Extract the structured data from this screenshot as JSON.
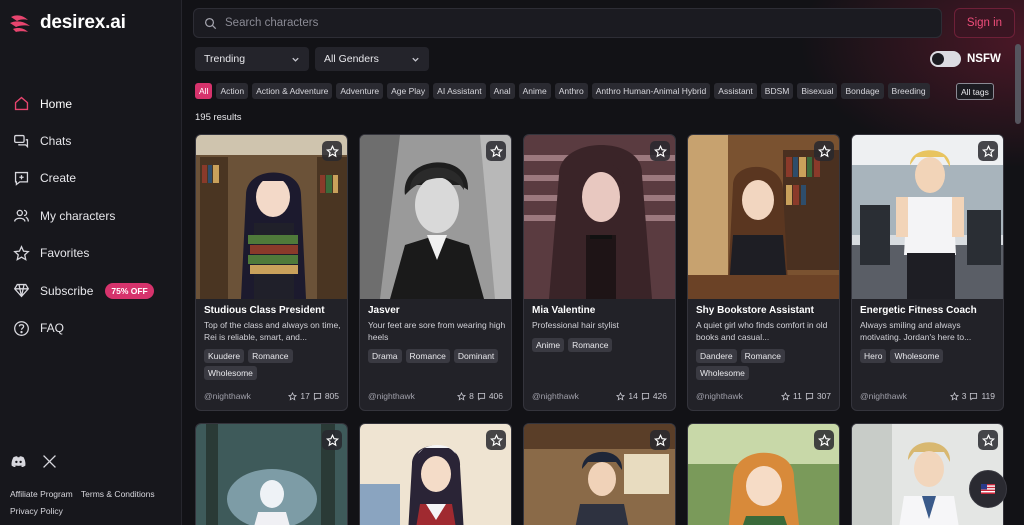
{
  "brand": {
    "name": "desirex.ai",
    "accent": "#d6336c"
  },
  "sidebar": {
    "items": [
      {
        "label": "Home",
        "icon": "home-icon"
      },
      {
        "label": "Chats",
        "icon": "chats-icon"
      },
      {
        "label": "Create",
        "icon": "create-icon"
      },
      {
        "label": "My characters",
        "icon": "users-icon"
      },
      {
        "label": "Favorites",
        "icon": "star-icon"
      },
      {
        "label": "Subscribe",
        "icon": "diamond-icon",
        "badge": "75% OFF"
      },
      {
        "label": "FAQ",
        "icon": "question-icon"
      }
    ],
    "social": [
      "discord-icon",
      "x-icon"
    ],
    "footer": {
      "affiliate": "Affiliate Program",
      "terms": "Terms & Conditions",
      "privacy": "Privacy Policy"
    }
  },
  "header": {
    "search_placeholder": "Search characters",
    "signin_label": "Sign in"
  },
  "filters": {
    "sort": "Trending",
    "gender": "All Genders",
    "nsfw_label": "NSFW",
    "nsfw_on": false
  },
  "tags": [
    "All",
    "Action",
    "Action & Adventure",
    "Adventure",
    "Age Play",
    "AI Assistant",
    "Anal",
    "Anime",
    "Anthro",
    "Anthro Human-Animal Hybrid",
    "Assistant",
    "BDSM",
    "Bisexual",
    "Bondage",
    "Breeding"
  ],
  "all_tags_label": "All tags",
  "results_label": "195 results",
  "cards": [
    {
      "name": "Studious Class President",
      "desc": "Top of the class and always on time, Rei is reliable, smart, and...",
      "tags": [
        "Kuudere",
        "Romance",
        "Wholesome"
      ],
      "author": "@nighthawk",
      "stars": "17",
      "chats": "805"
    },
    {
      "name": "Jasver",
      "desc": "Your feet are sore from wearing high heels",
      "tags": [
        "Drama",
        "Romance",
        "Dominant"
      ],
      "author": "@nighthawk",
      "stars": "8",
      "chats": "406"
    },
    {
      "name": "Mia Valentine",
      "desc": "Professional hair stylist",
      "tags": [
        "Anime",
        "Romance"
      ],
      "author": "@nighthawk",
      "stars": "14",
      "chats": "426"
    },
    {
      "name": "Shy Bookstore Assistant",
      "desc": "A quiet girl who finds comfort in old books and casual...",
      "tags": [
        "Dandere",
        "Romance",
        "Wholesome"
      ],
      "author": "@nighthawk",
      "stars": "11",
      "chats": "307"
    },
    {
      "name": "Energetic Fitness Coach",
      "desc": "Always smiling and always motivating. Jordan's here to...",
      "tags": [
        "Hero",
        "Wholesome"
      ],
      "author": "@nighthawk",
      "stars": "3",
      "chats": "119"
    }
  ]
}
